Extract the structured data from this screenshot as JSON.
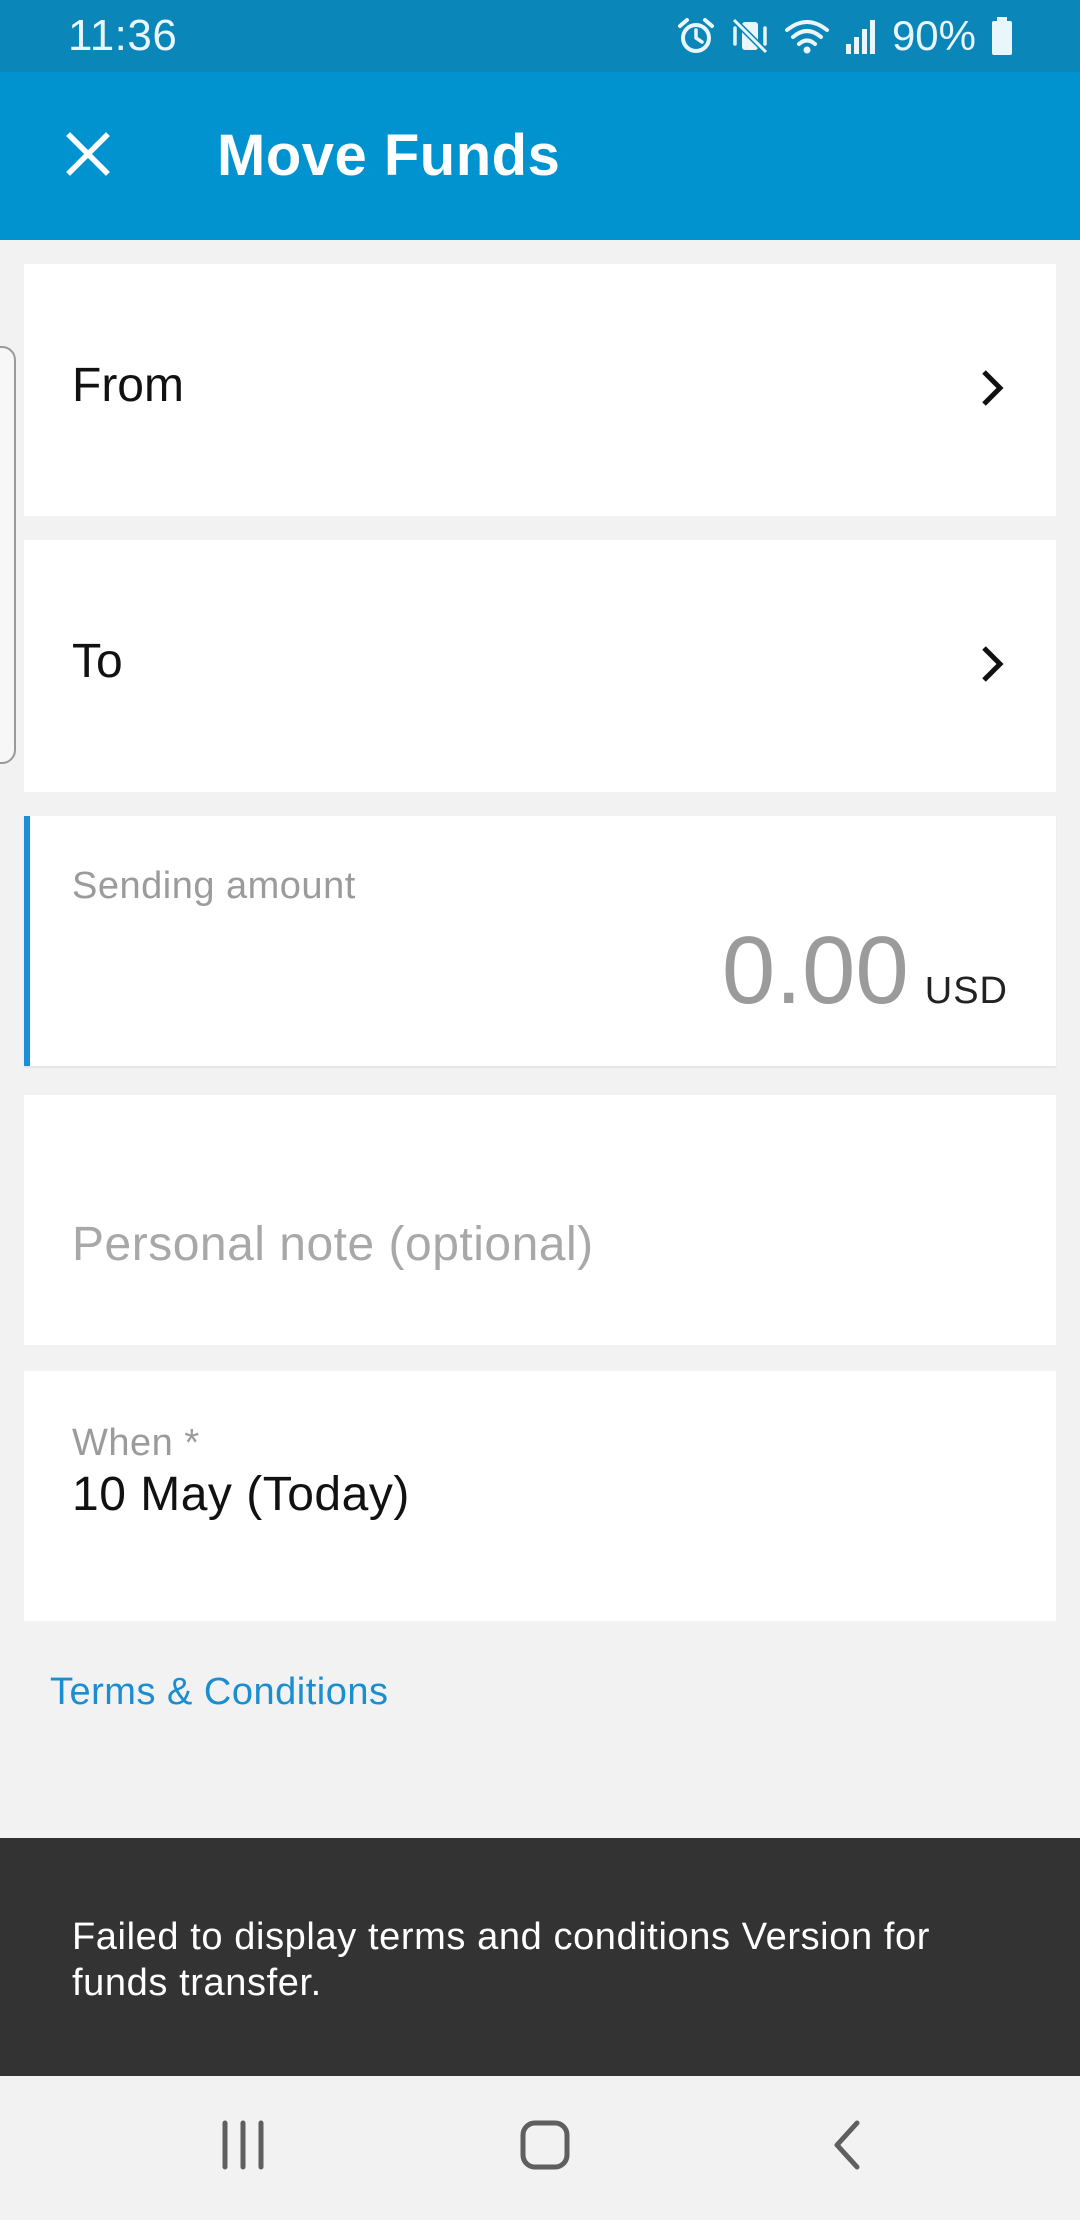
{
  "status_bar": {
    "time": "11:36",
    "battery_percent": "90%",
    "icons": [
      "alarm-icon",
      "mute-vibrate-icon",
      "wifi-icon",
      "signal-icon",
      "battery-icon"
    ]
  },
  "app_bar": {
    "title": "Move Funds",
    "close_icon": "close-icon"
  },
  "form": {
    "from_label": "From",
    "to_label": "To",
    "amount_label": "Sending amount",
    "amount_value": "0.00",
    "currency": "USD",
    "note_placeholder": "Personal note (optional)",
    "when_label": "When *",
    "when_value": "10 May (Today)"
  },
  "terms_link": "Terms & Conditions",
  "snackbar": {
    "message": "Failed to display terms and conditions Version for funds transfer."
  },
  "nav_bar": {
    "icons": [
      "recents-icon",
      "home-icon",
      "back-icon"
    ]
  },
  "colors": {
    "status_bar": "#0a86b8",
    "app_bar": "#0193cf",
    "accent": "#1c8fd6",
    "link": "#1a8ed1",
    "snackbar": "#333333",
    "background": "#f2f2f2"
  }
}
